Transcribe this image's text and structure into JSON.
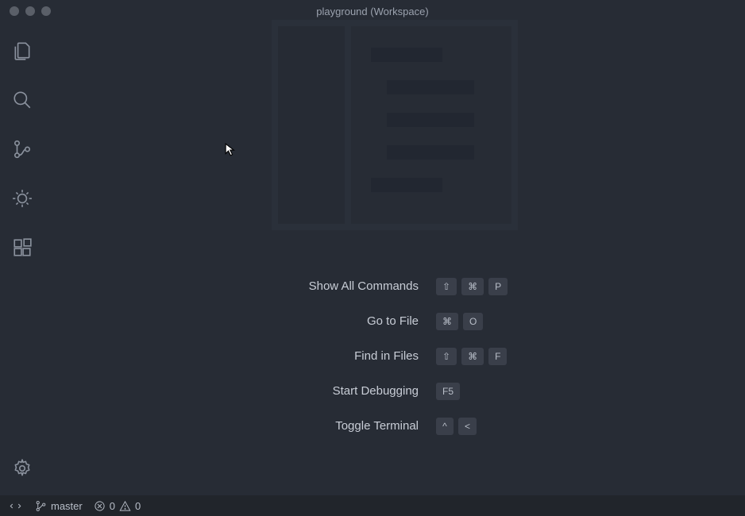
{
  "window": {
    "title": "playground (Workspace)"
  },
  "activity_bar": {
    "icons": [
      {
        "name": "files-icon"
      },
      {
        "name": "search-icon"
      },
      {
        "name": "source-control-icon"
      },
      {
        "name": "debug-icon"
      },
      {
        "name": "extensions-icon"
      }
    ],
    "bottom_icon": {
      "name": "settings-gear-icon"
    }
  },
  "welcome": {
    "shortcuts": [
      {
        "label": "Show All Commands",
        "keys": [
          "⇧",
          "⌘",
          "P"
        ]
      },
      {
        "label": "Go to File",
        "keys": [
          "⌘",
          "O"
        ]
      },
      {
        "label": "Find in Files",
        "keys": [
          "⇧",
          "⌘",
          "F"
        ]
      },
      {
        "label": "Start Debugging",
        "keys": [
          "F5"
        ]
      },
      {
        "label": "Toggle Terminal",
        "keys": [
          "^",
          "<"
        ]
      }
    ]
  },
  "status_bar": {
    "branch": "master",
    "errors": "0",
    "warnings": "0"
  }
}
